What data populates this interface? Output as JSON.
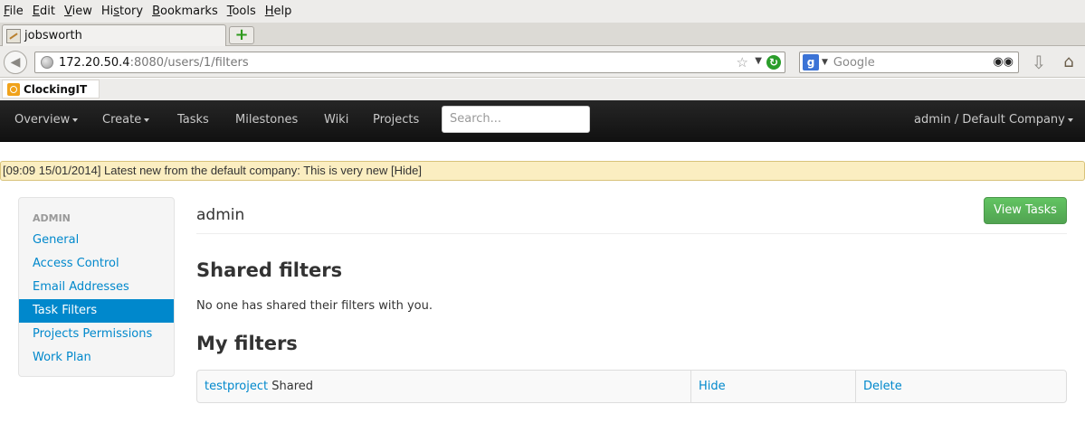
{
  "browser": {
    "menu": [
      {
        "u": "F",
        "rest": "ile"
      },
      {
        "u": "E",
        "rest": "dit"
      },
      {
        "u": "V",
        "rest": "iew"
      },
      {
        "pre": "Hi",
        "u": "s",
        "rest": "tory"
      },
      {
        "u": "B",
        "rest": "ookmarks"
      },
      {
        "u": "T",
        "rest": "ools"
      },
      {
        "u": "H",
        "rest": "elp"
      }
    ],
    "tab_title": "jobsworth",
    "url_host": "172.20.50.4",
    "url_path": ":8080/users/1/filters",
    "search_placeholder": "Google",
    "bookmark": "ClockingIT"
  },
  "nav": {
    "overview": "Overview",
    "create": "Create",
    "tasks": "Tasks",
    "milestones": "Milestones",
    "wiki": "Wiki",
    "projects": "Projects",
    "search_placeholder": "Search...",
    "user": "admin / Default Company"
  },
  "news": "[09:09 15/01/2014] Latest new from the default company: This is very new [Hide]",
  "sidebar": {
    "header": "ADMIN",
    "items": [
      "General",
      "Access Control",
      "Email Addresses",
      "Task Filters",
      "Projects Permissions",
      "Work Plan"
    ],
    "active_index": 3
  },
  "main": {
    "title": "admin",
    "view_tasks": "View Tasks",
    "shared_heading": "Shared filters",
    "shared_empty": "No one has shared their filters with you.",
    "my_heading": "My filters",
    "filters": [
      {
        "name": "testproject",
        "status": "Shared",
        "hide": "Hide",
        "delete": "Delete"
      }
    ]
  }
}
